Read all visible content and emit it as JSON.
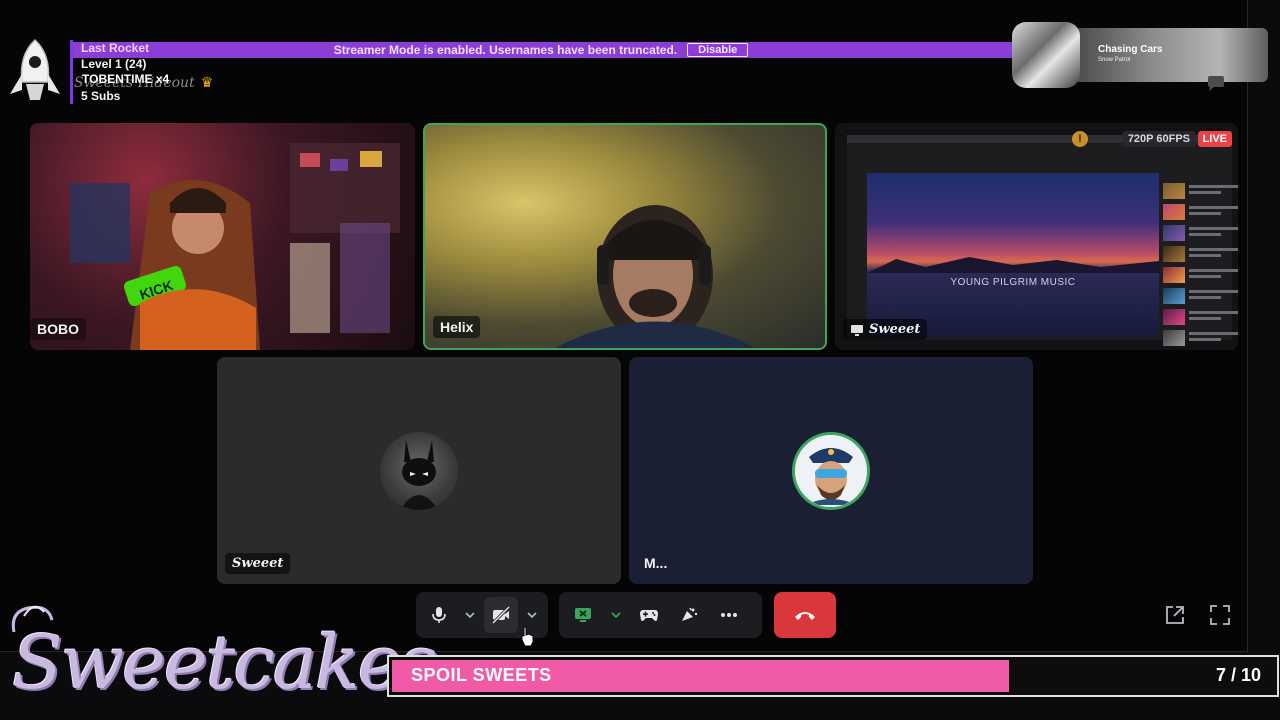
{
  "overlay": {
    "rocket_title": "Last Rocket",
    "rocket_level": "Level 1  (24)",
    "rocket_note": "TOBENTIME x4",
    "rocket_subs": "5 Subs",
    "channel_name": "Sweeets Hideout",
    "crown_glyph": "♛"
  },
  "banner": {
    "message": "Streamer Mode is enabled. Usernames have been truncated.",
    "disable_label": "Disable",
    "color": "#8c3dd6"
  },
  "now_playing": {
    "song": "Chasing Cars",
    "artist": "Snow Patrol"
  },
  "tiles": {
    "bobo": {
      "name": "BOBO"
    },
    "helix": {
      "name": "Helix",
      "speaking_color": "#3ba55c"
    },
    "stream": {
      "name": "Sweeet",
      "quality": "720P 60FPS",
      "live": "LIVE",
      "warning": "!",
      "video_caption": "YOUNG PILGRIM MUSIC"
    },
    "sweeet_cam": {
      "name": "Sweeet"
    },
    "m": {
      "name": "M..."
    }
  },
  "controls": {
    "icons": [
      "microphone-icon",
      "camera-off-icon",
      "screen-share-icon",
      "gamepad-icon",
      "soundboard-icon",
      "more-icon",
      "hangup-icon",
      "popout-icon",
      "fullscreen-icon"
    ],
    "hangup_color": "#da373c",
    "share_color": "#3ba55c"
  },
  "bottom": {
    "brand": "Sweetcakes",
    "goal_label": "SPOIL SWEETS",
    "goal_count": "7 / 10",
    "goal_fraction": 0.7,
    "goal_color": "#f15aa7"
  }
}
